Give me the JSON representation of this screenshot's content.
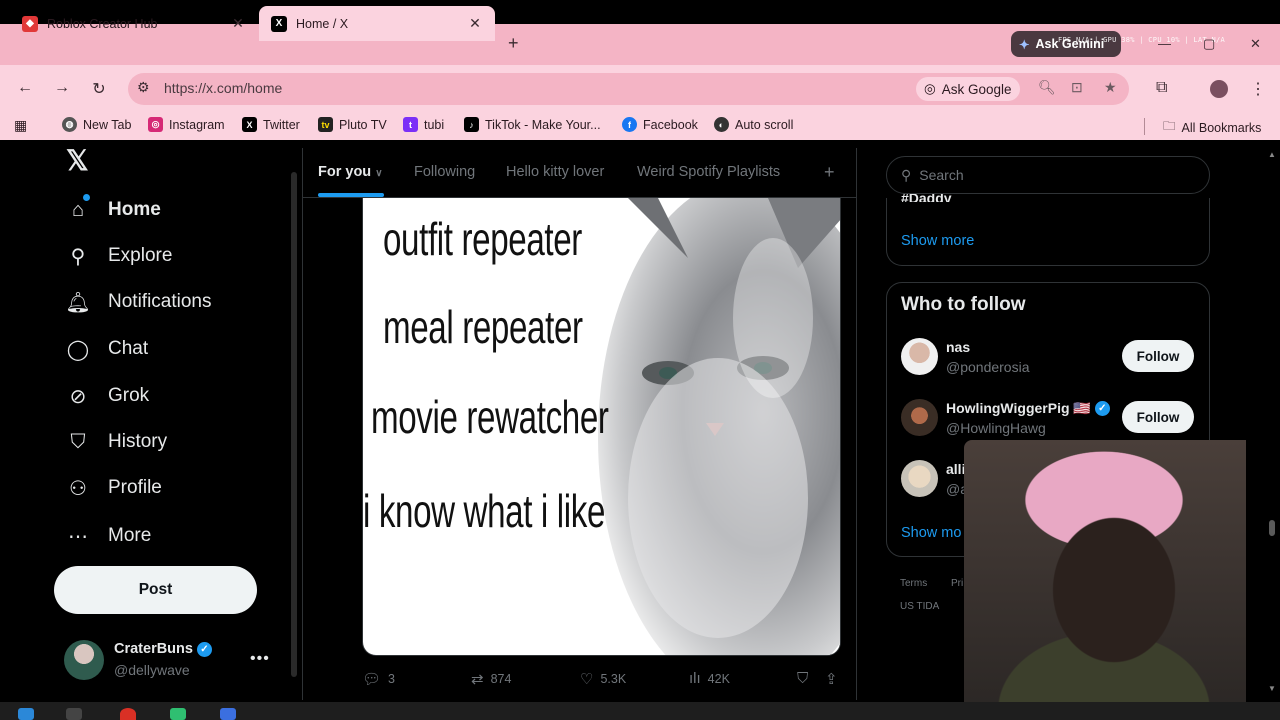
{
  "browser": {
    "tabs": [
      {
        "title": "Roblox Creator Hub",
        "icon": "roblox-icon"
      },
      {
        "title": "Home / X",
        "icon": "x-icon"
      }
    ],
    "gemini_label": "Ask Gemini",
    "overlay_stats": "FPS N/A | GPU 38% | CPU 10% | LAT N/A",
    "url": "https://x.com/home",
    "ask_google": "Ask Google",
    "bookmarks": [
      "New Tab",
      "Instagram",
      "Twitter",
      "Pluto TV",
      "tubi",
      "TikTok - Make Your...",
      "Facebook",
      "Auto scroll"
    ],
    "all_bookmarks": "All Bookmarks"
  },
  "nav": {
    "items": [
      "Home",
      "Explore",
      "Notifications",
      "Chat",
      "Grok",
      "History",
      "Profile",
      "More"
    ],
    "post": "Post",
    "account": {
      "name": "CraterBuns",
      "handle": "@dellywave"
    }
  },
  "feed": {
    "tabs": [
      "For you",
      "Following",
      "Hello kitty lover",
      "Weird Spotify Playlists"
    ],
    "meme_lines": [
      "outfit repeater",
      "meal repeater",
      "movie rewatcher",
      "i know what i like"
    ],
    "stats": {
      "replies": "3",
      "reposts": "874",
      "likes": "5.3K",
      "views": "42K"
    }
  },
  "sidebar": {
    "search_placeholder": "Search",
    "trend_cut": "#Daddy",
    "show_more": "Show more",
    "who_to_follow": "Who to follow",
    "follow_label": "Follow",
    "people": [
      {
        "name": "nas",
        "handle": "@ponderosia",
        "verified": false
      },
      {
        "name": "HowlingWiggerPig 🇺🇸",
        "handle": "@HowlingHawg",
        "verified": true
      },
      {
        "name": "allison har",
        "handle": "@alliha",
        "verified": false
      }
    ],
    "show_more_2": "Show mo",
    "footer": [
      "Terms",
      "Pri",
      "US TIDA"
    ]
  }
}
